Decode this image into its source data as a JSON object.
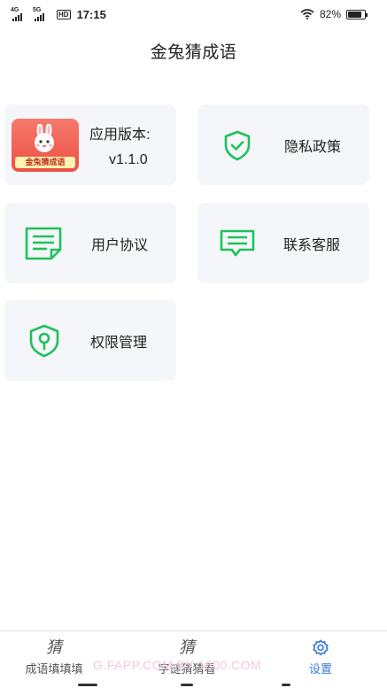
{
  "status_bar": {
    "network1": "4G",
    "network2": "5G",
    "hd": "HD",
    "time": "17:15",
    "battery": "82%",
    "battery_level": 0.82
  },
  "header": {
    "title": "金兔猜成语"
  },
  "cards": {
    "version": {
      "label": "应用版本:",
      "value": "v1.1.0",
      "logo_text": "金兔猜成语"
    },
    "privacy": {
      "label": "隐私政策"
    },
    "agreement": {
      "label": "用户协议"
    },
    "contact": {
      "label": "联系客服"
    },
    "permissions": {
      "label": "权限管理"
    }
  },
  "tabbar": {
    "tabs": [
      {
        "label": "成语填填填",
        "icon": "猜"
      },
      {
        "label": "字谜猜猜看",
        "icon": "猜"
      },
      {
        "label": "设置",
        "icon": "gear-icon"
      }
    ],
    "watermark": "G.FAPP.COM  BY 1800.COM"
  },
  "colors": {
    "accent_green": "#1fc15a",
    "active_tab": "#3a7bd5",
    "card_bg": "#f4f6f9"
  }
}
